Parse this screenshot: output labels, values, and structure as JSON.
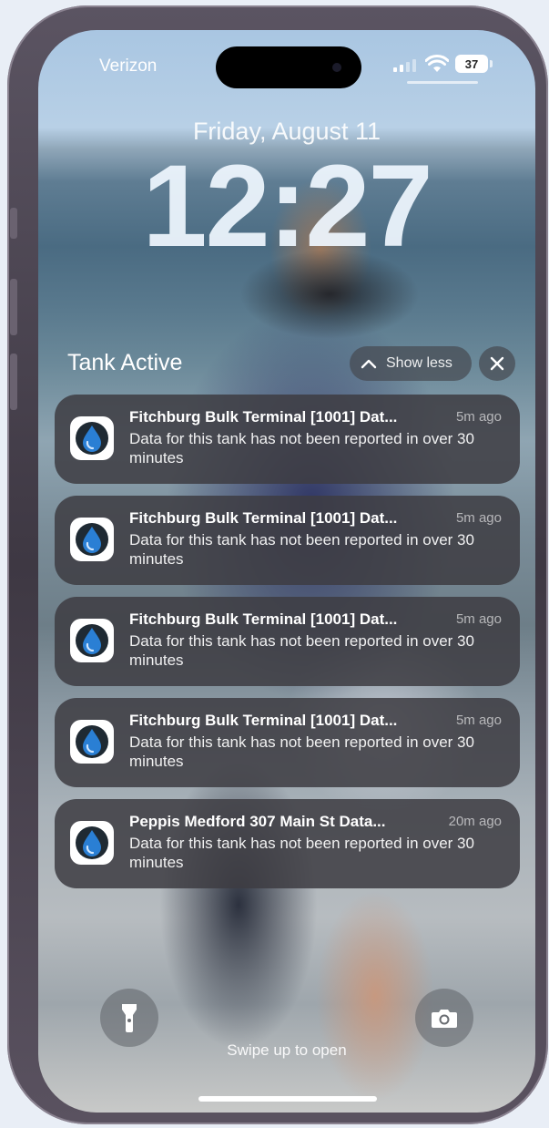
{
  "status_bar": {
    "carrier": "Verizon",
    "battery": "37"
  },
  "lock_screen": {
    "date": "Friday, August 11",
    "time": "12:27"
  },
  "notification_group": {
    "title": "Tank Active",
    "show_less_label": "Show less"
  },
  "notifications": [
    {
      "title": "Fitchburg Bulk Terminal [1001] Dat...",
      "time": "5m ago",
      "body": "Data for this tank has not been reported in over 30 minutes"
    },
    {
      "title": "Fitchburg Bulk Terminal [1001] Dat...",
      "time": "5m ago",
      "body": "Data for this tank has not been reported in over 30 minutes"
    },
    {
      "title": "Fitchburg Bulk Terminal [1001] Dat...",
      "time": "5m ago",
      "body": "Data for this tank has not been reported in over 30 minutes"
    },
    {
      "title": "Fitchburg Bulk Terminal [1001] Dat...",
      "time": "5m ago",
      "body": "Data for this tank has not been reported in over 30 minutes"
    },
    {
      "title": "Peppis Medford 307 Main St Data...",
      "time": "20m ago",
      "body": "Data for this tank has not been reported in over 30 minutes"
    }
  ],
  "bottom": {
    "swipe_hint": "Swipe up to open",
    "flashlight_icon": "flashlight-icon",
    "camera_icon": "camera-icon"
  },
  "colors": {
    "notification_bg": "#3e3c42",
    "app_icon_drop": "#2a7fd4"
  }
}
